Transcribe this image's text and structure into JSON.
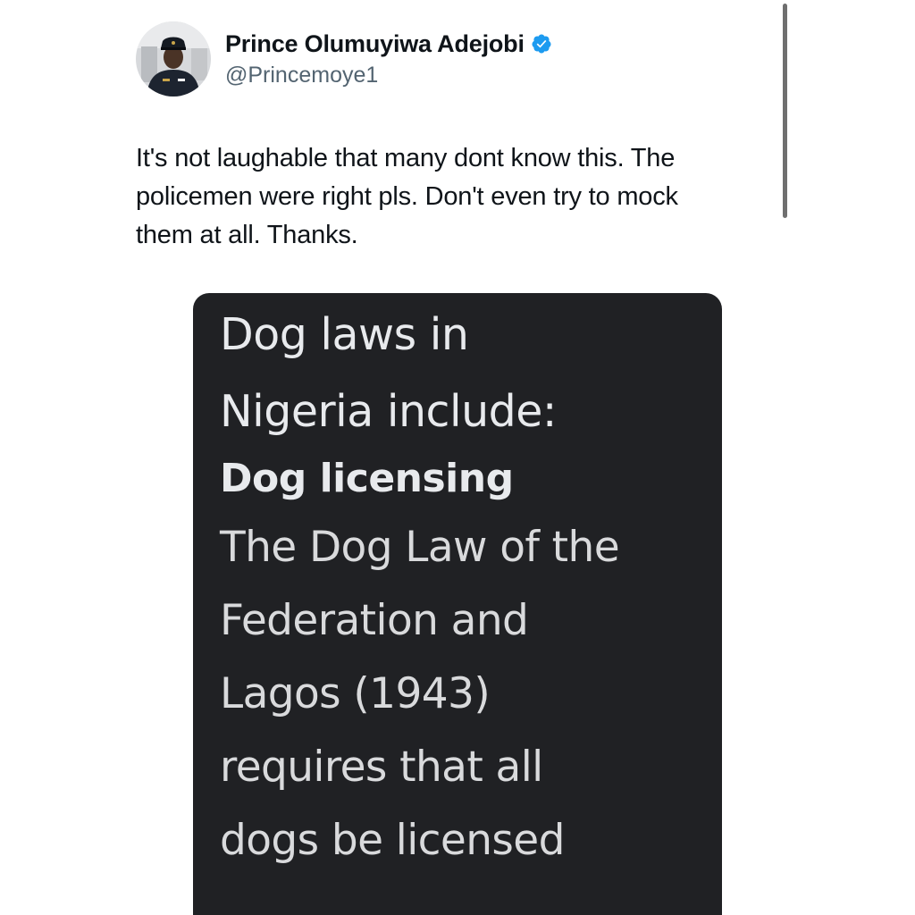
{
  "author": {
    "display_name": "Prince Olumuyiwa Adejobi",
    "handle": "@Princemoye1",
    "verified": true,
    "verified_color": "#1d9bf0"
  },
  "tweet": {
    "text_lines": [
      "It's not laughable that many dont know this. The",
      "policemen were right pls. Don't even try to mock",
      "them at all. Thanks."
    ]
  },
  "media": {
    "heading_lines": [
      "Dog laws in",
      "Nigeria include:"
    ],
    "subheading": "Dog licensing",
    "body_lines": [
      "The Dog Law of the",
      "Federation and",
      "Lagos (1943)",
      "requires that all",
      "dogs be licensed"
    ],
    "background": "#202124"
  }
}
